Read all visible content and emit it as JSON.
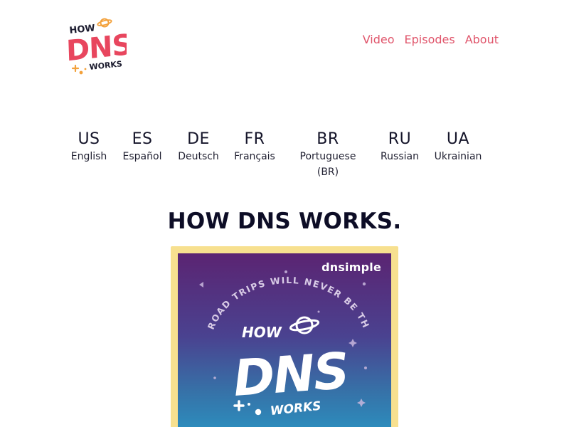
{
  "header": {
    "logo": {
      "word_top": "HOW",
      "word_main": "DNS",
      "word_bottom": "WORKS"
    },
    "nav": [
      {
        "label": "Video"
      },
      {
        "label": "Episodes"
      },
      {
        "label": "About"
      }
    ]
  },
  "languages": [
    {
      "code": "US",
      "name": "English"
    },
    {
      "code": "ES",
      "name": "Español"
    },
    {
      "code": "DE",
      "name": "Deutsch"
    },
    {
      "code": "FR",
      "name": "Français"
    },
    {
      "code": "BR",
      "name": "Portuguese (BR)"
    },
    {
      "code": "RU",
      "name": "Russian"
    },
    {
      "code": "UA",
      "name": "Ukrainian"
    }
  ],
  "main": {
    "title": "HOW DNS WORKS."
  },
  "cover": {
    "brand": "dnsimple",
    "arc_text": "ROAD TRIPS WILL NEVER BE THE SAME",
    "word_top": "HOW",
    "word_main": "DNS",
    "word_bottom": "WORKS"
  },
  "colors": {
    "accent": "#e0556b",
    "logo_red": "#e8465e",
    "logo_orange": "#f3a13b",
    "cover_frame": "#f7e08f",
    "cover_top": "#5b2472",
    "cover_bottom": "#2a93c2",
    "text_dark": "#0d0d26"
  }
}
